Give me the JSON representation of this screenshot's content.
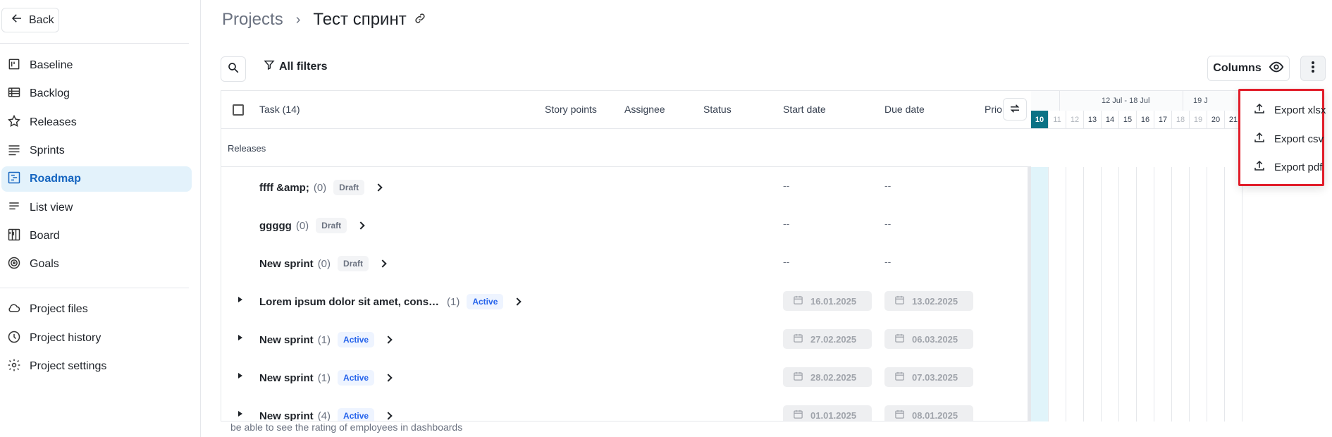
{
  "sidebar": {
    "back_label": "Back",
    "items": [
      {
        "label": "Baseline",
        "icon": "baseline-icon"
      },
      {
        "label": "Backlog",
        "icon": "backlog-icon"
      },
      {
        "label": "Releases",
        "icon": "star-icon"
      },
      {
        "label": "Sprints",
        "icon": "sprints-icon"
      },
      {
        "label": "Roadmap",
        "icon": "roadmap-icon",
        "active": true
      },
      {
        "label": "List view",
        "icon": "list-icon"
      },
      {
        "label": "Board",
        "icon": "board-icon"
      },
      {
        "label": "Goals",
        "icon": "target-icon"
      }
    ],
    "secondary_items": [
      {
        "label": "Project files",
        "icon": "cloud-icon"
      },
      {
        "label": "Project history",
        "icon": "clock-icon"
      },
      {
        "label": "Project settings",
        "icon": "gear-icon"
      }
    ]
  },
  "header": {
    "parent": "Projects",
    "separator": "›",
    "current": "Тест спринт"
  },
  "toolbar": {
    "filters_label": "All filters",
    "columns_label": "Columns"
  },
  "table": {
    "headers": {
      "task": "Task (14)",
      "story_points": "Story points",
      "assignee": "Assignee",
      "status": "Status",
      "start_date": "Start date",
      "due_date": "Due date",
      "priority": "Prio"
    },
    "group_label": "Releases",
    "rows": [
      {
        "title": "ffff &amp;",
        "count": "(0)",
        "badge": "Draft",
        "badge_type": "draft",
        "start": "--",
        "due": "--",
        "expandable": false
      },
      {
        "title": "ggggg",
        "count": "(0)",
        "badge": "Draft",
        "badge_type": "draft",
        "start": "--",
        "due": "--",
        "expandable": false
      },
      {
        "title": "New sprint",
        "count": "(0)",
        "badge": "Draft",
        "badge_type": "draft",
        "start": "--",
        "due": "--",
        "expandable": false
      },
      {
        "title": "Lorem ipsum dolor sit amet, consect…",
        "count": "(1)",
        "badge": "Active",
        "badge_type": "active",
        "start": "16.01.2025",
        "due": "13.02.2025",
        "expandable": true
      },
      {
        "title": "New sprint",
        "count": "(1)",
        "badge": "Active",
        "badge_type": "active",
        "start": "27.02.2025",
        "due": "06.03.2025",
        "expandable": true
      },
      {
        "title": "New sprint",
        "count": "(1)",
        "badge": "Active",
        "badge_type": "active",
        "start": "28.02.2025",
        "due": "07.03.2025",
        "expandable": true
      },
      {
        "title": "New sprint",
        "count": "(4)",
        "badge": "Active",
        "badge_type": "active",
        "start": "01.01.2025",
        "due": "08.01.2025",
        "expandable": true
      }
    ],
    "bottom_caption": "be able to see the rating of employees in dashboards"
  },
  "gantt": {
    "week_labels": [
      "12 Jul - 18 Jul",
      "19 J"
    ],
    "days": [
      {
        "d": "10",
        "type": "today"
      },
      {
        "d": "11",
        "type": "weekend"
      },
      {
        "d": "12",
        "type": "weekend"
      },
      {
        "d": "13",
        "type": "normal"
      },
      {
        "d": "14",
        "type": "normal"
      },
      {
        "d": "15",
        "type": "normal"
      },
      {
        "d": "16",
        "type": "normal"
      },
      {
        "d": "17",
        "type": "normal"
      },
      {
        "d": "18",
        "type": "weekend"
      },
      {
        "d": "19",
        "type": "weekend"
      },
      {
        "d": "20",
        "type": "normal"
      },
      {
        "d": "21",
        "type": "normal"
      }
    ],
    "colors": {
      "today": "#0b7285",
      "today_col": "#e0f4fa"
    }
  },
  "export_menu": {
    "items": [
      "Export xlsx",
      "Export csv",
      "Export pdf"
    ],
    "highlight_color": "#e11d2a"
  }
}
